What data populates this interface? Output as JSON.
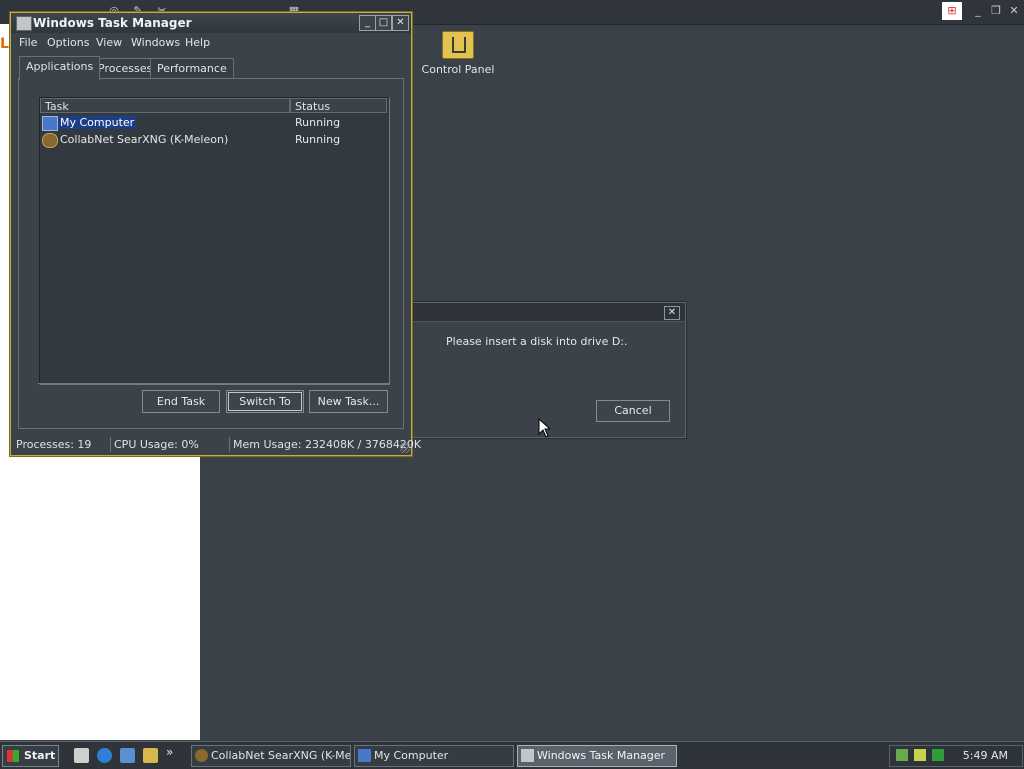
{
  "taskmgr": {
    "title": "Windows Task Manager",
    "menu": [
      "File",
      "Options",
      "View",
      "Windows",
      "Help"
    ],
    "tabs": [
      "Applications",
      "Processes",
      "Performance"
    ],
    "columns": [
      "Task",
      "Status"
    ],
    "tasks": [
      {
        "name": "My Computer",
        "status": "Running"
      },
      {
        "name": "CollabNet SearXNG (K-Meleon)",
        "status": "Running"
      }
    ],
    "buttons": {
      "end_task": "End Task",
      "switch_to": "Switch To",
      "new_task": "New Task..."
    },
    "status": {
      "processes": "Processes: 19",
      "cpu": "CPU Usage: 0%",
      "mem": "Mem Usage: 232408K / 3768420K"
    }
  },
  "desktop": {
    "control_panel_label": "Control Panel"
  },
  "dialog": {
    "message": "Please insert a disk into drive D:.",
    "cancel_label": "Cancel"
  },
  "taskbar": {
    "start_label": "Start",
    "tasks": [
      "CollabNet SearXNG (K-Mel...",
      "My Computer",
      "Windows Task Manager"
    ],
    "clock": "5:49 AM"
  }
}
